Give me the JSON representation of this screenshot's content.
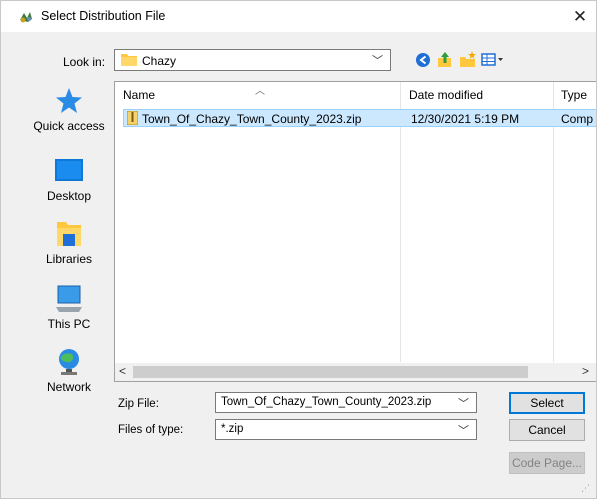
{
  "window": {
    "title": "Select Distribution File",
    "close_glyph": "✕"
  },
  "toolbar": {
    "look_in_label": "Look in:",
    "look_in_value": "Chazy",
    "icons": [
      "back-icon",
      "up-folder-icon",
      "new-folder-icon",
      "view-menu-icon"
    ]
  },
  "places": [
    {
      "label": "Quick access",
      "icon": "quick-access-star-icon"
    },
    {
      "label": "Desktop",
      "icon": "desktop-icon"
    },
    {
      "label": "Libraries",
      "icon": "libraries-icon"
    },
    {
      "label": "This PC",
      "icon": "this-pc-icon"
    },
    {
      "label": "Network",
      "icon": "network-icon"
    }
  ],
  "file_list": {
    "columns": [
      "Name",
      "Date modified",
      "Type"
    ],
    "rows": [
      {
        "name": "Town_Of_Chazy_Town_County_2023.zip",
        "date": "12/30/2021 5:19 PM",
        "type": "Comp",
        "selected": true
      }
    ]
  },
  "form": {
    "zip_label": "Zip File:",
    "zip_value": "Town_Of_Chazy_Town_County_2023.zip",
    "type_label": "Files of type:",
    "type_value": "*.zip"
  },
  "buttons": {
    "select": "Select",
    "cancel": "Cancel",
    "code_page": "Code Page..."
  },
  "colors": {
    "selection_bg": "#cce8ff",
    "accent": "#0078d7",
    "folder": "#ffc83d"
  }
}
